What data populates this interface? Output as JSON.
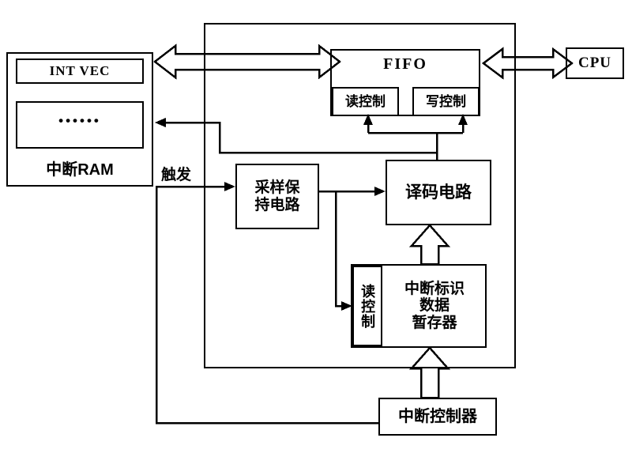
{
  "diagram": {
    "title": "Interrupt vector / FIFO block diagram",
    "stroke_color": "#000000",
    "background_color": "#ffffff"
  },
  "blocks": {
    "ram": {
      "label": "中断RAM",
      "int_vec": "INT  VEC",
      "cells_placeholder": "••••••"
    },
    "fifo": {
      "title": "FIFO",
      "read_control": "读控制",
      "write_control": "写控制"
    },
    "cpu": {
      "label": "CPU"
    },
    "sample_hold": {
      "line1": "采样保",
      "line2": "持电路"
    },
    "decoder": {
      "label": "译码电路"
    },
    "register": {
      "read_control": "读控制",
      "line1": "中断标识",
      "line2": "数据",
      "line3": "暂存器"
    },
    "interrupt_controller": {
      "label": "中断控制器"
    }
  },
  "labels": {
    "trigger": "触发"
  },
  "connections": [
    {
      "name": "ram-fifo-bus",
      "style": "double-block-arrow",
      "from": "ram",
      "to": "fifo"
    },
    {
      "name": "fifo-cpu-bus",
      "style": "double-block-arrow",
      "from": "fifo",
      "to": "cpu"
    },
    {
      "name": "decoder-ram",
      "style": "thin-arrow",
      "from": "decoder-bus",
      "to": "ram"
    },
    {
      "name": "decoder-read-control",
      "style": "thin-arrow",
      "from": "decoder",
      "to": "fifo-read-control"
    },
    {
      "name": "decoder-write-control",
      "style": "thin-arrow",
      "from": "decoder",
      "to": "fifo-write-control"
    },
    {
      "name": "trigger-sample-hold",
      "style": "thin-arrow",
      "from": "trigger",
      "to": "sample_hold"
    },
    {
      "name": "sample-hold-decoder",
      "style": "thin-arrow",
      "from": "sample_hold",
      "to": "decoder"
    },
    {
      "name": "sample-hold-register-read-control",
      "style": "thin-arrow",
      "from": "sample_hold",
      "to": "register-read-control"
    },
    {
      "name": "register-decoder",
      "style": "block-arrow-up",
      "from": "register",
      "to": "decoder"
    },
    {
      "name": "controller-register",
      "style": "block-arrow-up",
      "from": "interrupt_controller",
      "to": "register"
    },
    {
      "name": "controller-trigger",
      "style": "plain-line",
      "from": "interrupt_controller",
      "to": "trigger"
    }
  ]
}
